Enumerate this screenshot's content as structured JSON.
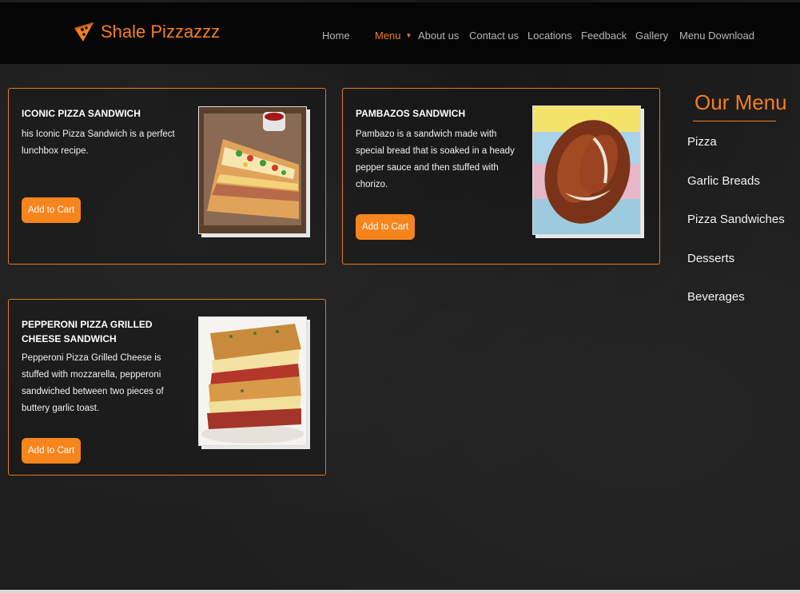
{
  "brand": {
    "name": "Shale Pizzazzz",
    "accent": "#f47f20",
    "icon": "pizza-slice-icon"
  },
  "nav": {
    "items": [
      {
        "label": "Home",
        "active": false
      },
      {
        "label": "Menu",
        "active": true,
        "has_dropdown": true
      },
      {
        "label": "About us",
        "active": false
      },
      {
        "label": "Contact us",
        "active": false
      },
      {
        "label": "Locations",
        "active": false
      },
      {
        "label": "Feedback",
        "active": false
      },
      {
        "label": "Gallery",
        "active": false
      },
      {
        "label": "Menu Download",
        "active": false
      }
    ]
  },
  "products": [
    {
      "title": "ICONIC PIZZA SANDWICH",
      "description": "his Iconic Pizza Sandwich is a perfect lunchbox recipe.",
      "button": "Add to Cart"
    },
    {
      "title": "PAMBAZOS SANDWICH",
      "description": "Pambazo is a sandwich made with special bread that is soaked in a heady pepper sauce and then stuffed with chorizo.",
      "button": "Add to Cart"
    },
    {
      "title": "PEPPERONI PIZZA GRILLED CHEESE SANDWICH",
      "description": "Pepperoni Pizza Grilled Cheese is stuffed with mozzarella, pepperoni sandwiched between two pieces of buttery garlic toast.",
      "button": "Add to Cart"
    }
  ],
  "sidebar": {
    "title": "Our Menu",
    "items": [
      "Pizza",
      "Garlic Breads",
      "Pizza Sandwiches",
      "Desserts",
      "Beverages"
    ]
  }
}
